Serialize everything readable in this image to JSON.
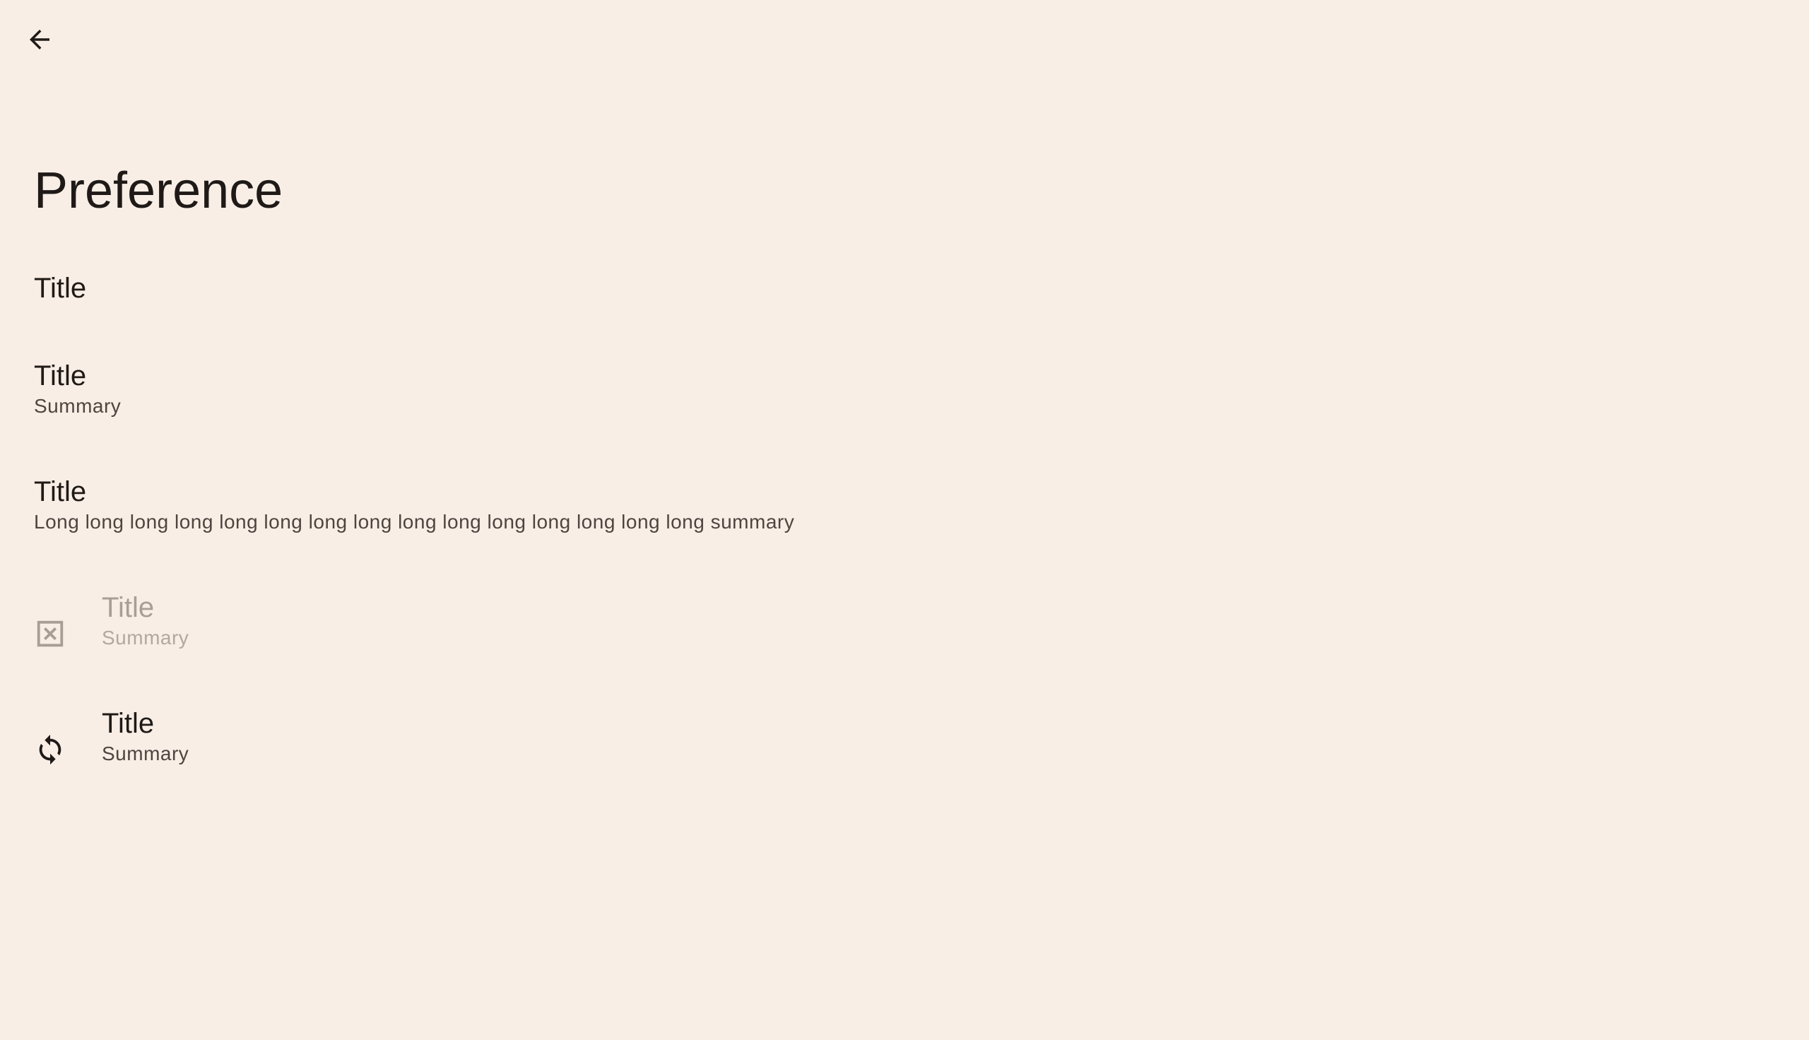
{
  "app": {
    "background": "#F8EEE6"
  },
  "toolbar": {
    "back_icon": "arrow-back-icon"
  },
  "page": {
    "title": "Preference"
  },
  "preferences": [
    {
      "title": "Title",
      "summary": "",
      "icon": "",
      "enabled": true
    },
    {
      "title": "Title",
      "summary": "Summary",
      "icon": "",
      "enabled": true
    },
    {
      "title": "Title",
      "summary": "Long long long long long long long long long long long long long long long summary",
      "icon": "",
      "enabled": true
    },
    {
      "title": "Title",
      "summary": "Summary",
      "icon": "disabled-box-x-icon",
      "enabled": false
    },
    {
      "title": "Title",
      "summary": "Summary",
      "icon": "sync-icon",
      "enabled": true
    }
  ],
  "colors": {
    "text_primary": "#1F1A17",
    "text_secondary": "#4F4540",
    "text_disabled": "#A99D96"
  }
}
